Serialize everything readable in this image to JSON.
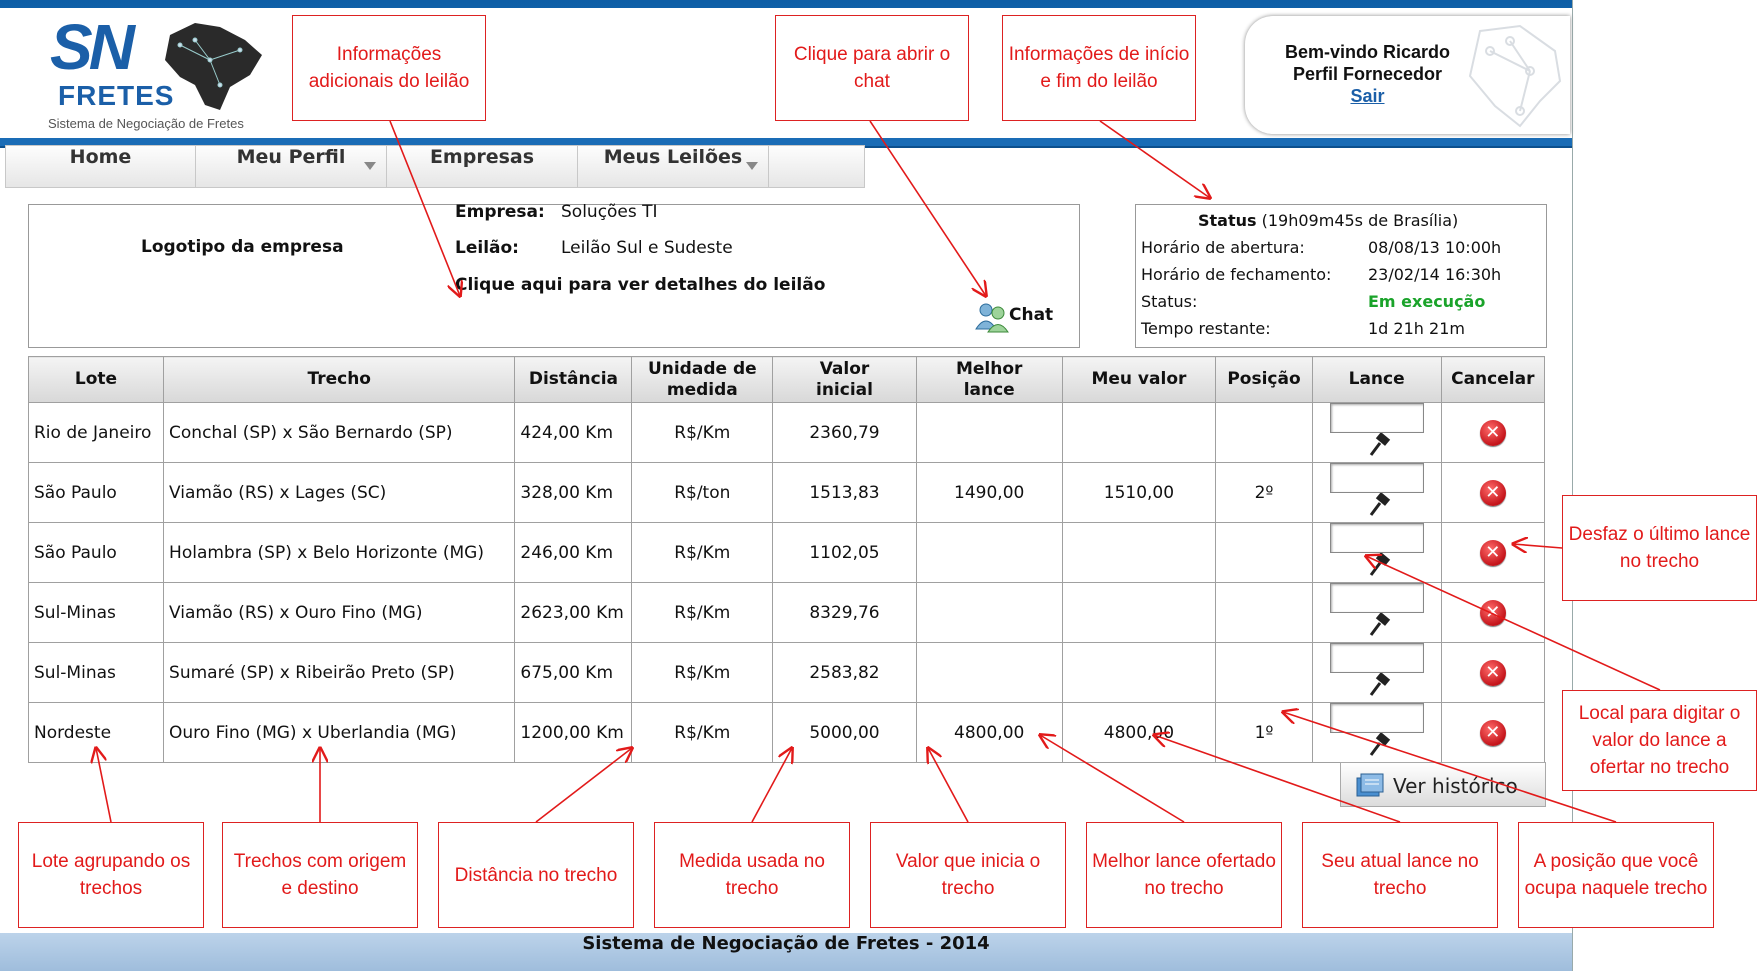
{
  "header": {
    "logo_sn": "SN",
    "logo_fretes": "FRETES",
    "logo_subtitle": "Sistema de Negociação de Fretes",
    "welcome": "Bem-vindo Ricardo",
    "profile": "Perfil Fornecedor",
    "logout": "Sair"
  },
  "nav": {
    "items": [
      {
        "label": "Home"
      },
      {
        "label": "Meu Perfil"
      },
      {
        "label": "Empresas"
      },
      {
        "label": "Meus Leilões"
      }
    ]
  },
  "company": {
    "logo_placeholder": "Logotipo da empresa",
    "empresa_label": "Empresa:",
    "empresa_value": "Soluções TI",
    "leilao_label": "Leilão:",
    "leilao_value": "Leilão Sul e Sudeste",
    "details_link": "Clique aqui para ver detalhes do leilão",
    "chat_label": "Chat"
  },
  "status": {
    "title": "Status",
    "time_note": "(19h09m45s de Brasília)",
    "opening_label": "Horário de abertura:",
    "opening_value": "08/08/13 10:00h",
    "closing_label": "Horário de fechamento:",
    "closing_value": "23/02/14 16:30h",
    "status_label": "Status:",
    "status_value": "Em execução",
    "remaining_label": "Tempo restante:",
    "remaining_value": "1d 21h 21m",
    "status_color": "#1aa32a"
  },
  "table": {
    "headers": [
      "Lote",
      "Trecho",
      "Distância",
      "Unidade de medida",
      "Valor inicial",
      "Melhor lance",
      "Meu valor",
      "Posição",
      "Lance",
      "Cancelar"
    ],
    "rows": [
      {
        "lote": "Rio de Janeiro",
        "trecho": "Conchal (SP) x São Bernardo (SP)",
        "distancia": "424,00 Km",
        "unidade": "R$/Km",
        "valor_inicial": "2360,79",
        "melhor_lance": "",
        "meu_valor": "",
        "posicao": ""
      },
      {
        "lote": "São Paulo",
        "trecho": "Viamão (RS) x Lages (SC)",
        "distancia": "328,00 Km",
        "unidade": "R$/ton",
        "valor_inicial": "1513,83",
        "melhor_lance": "1490,00",
        "meu_valor": "1510,00",
        "posicao": "2º"
      },
      {
        "lote": "São Paulo",
        "trecho": "Holambra (SP) x Belo Horizonte (MG)",
        "distancia": "246,00 Km",
        "unidade": "R$/Km",
        "valor_inicial": "1102,05",
        "melhor_lance": "",
        "meu_valor": "",
        "posicao": ""
      },
      {
        "lote": "Sul-Minas",
        "trecho": "Viamão (RS) x Ouro Fino (MG)",
        "distancia": "2623,00 Km",
        "unidade": "R$/Km",
        "valor_inicial": "8329,76",
        "melhor_lance": "",
        "meu_valor": "",
        "posicao": ""
      },
      {
        "lote": "Sul-Minas",
        "trecho": "Sumaré (SP) x Ribeirão Preto (SP)",
        "distancia": "675,00 Km",
        "unidade": "R$/Km",
        "valor_inicial": "2583,82",
        "melhor_lance": "",
        "meu_valor": "",
        "posicao": ""
      },
      {
        "lote": "Nordeste",
        "trecho": "Ouro Fino (MG) x Uberlandia (MG)",
        "distancia": "1200,00 Km",
        "unidade": "R$/Km",
        "valor_inicial": "5000,00",
        "melhor_lance": "4800,00",
        "meu_valor": "4800,00",
        "posicao": "1º"
      }
    ]
  },
  "history_button": "Ver histórico",
  "footer": "Sistema de Negociação de Fretes - 2014",
  "callouts": {
    "info_leilao": "Informações adicionais do leilão",
    "chat": "Clique para abrir o chat",
    "inicio_fim": "Informações de início e fim do leilão",
    "desfaz": "Desfaz o último lance no trecho",
    "local_lance": "Local para digitar o valor do lance a ofertar no trecho",
    "lote": "Lote agrupando os trechos",
    "trechos": "Trechos com origem e destino",
    "distancia": "Distância no trecho",
    "medida": "Medida usada no trecho",
    "valor_inicial": "Valor que inicia o trecho",
    "melhor_lance": "Melhor lance ofertado no trecho",
    "seu_lance": "Seu atual lance no trecho",
    "posicao": "A posição que você ocupa naquele trecho"
  },
  "colors": {
    "brand_blue": "#1b5fa8",
    "callout_red": "#e21a1a",
    "footer_blue": "#a9c5e2"
  }
}
